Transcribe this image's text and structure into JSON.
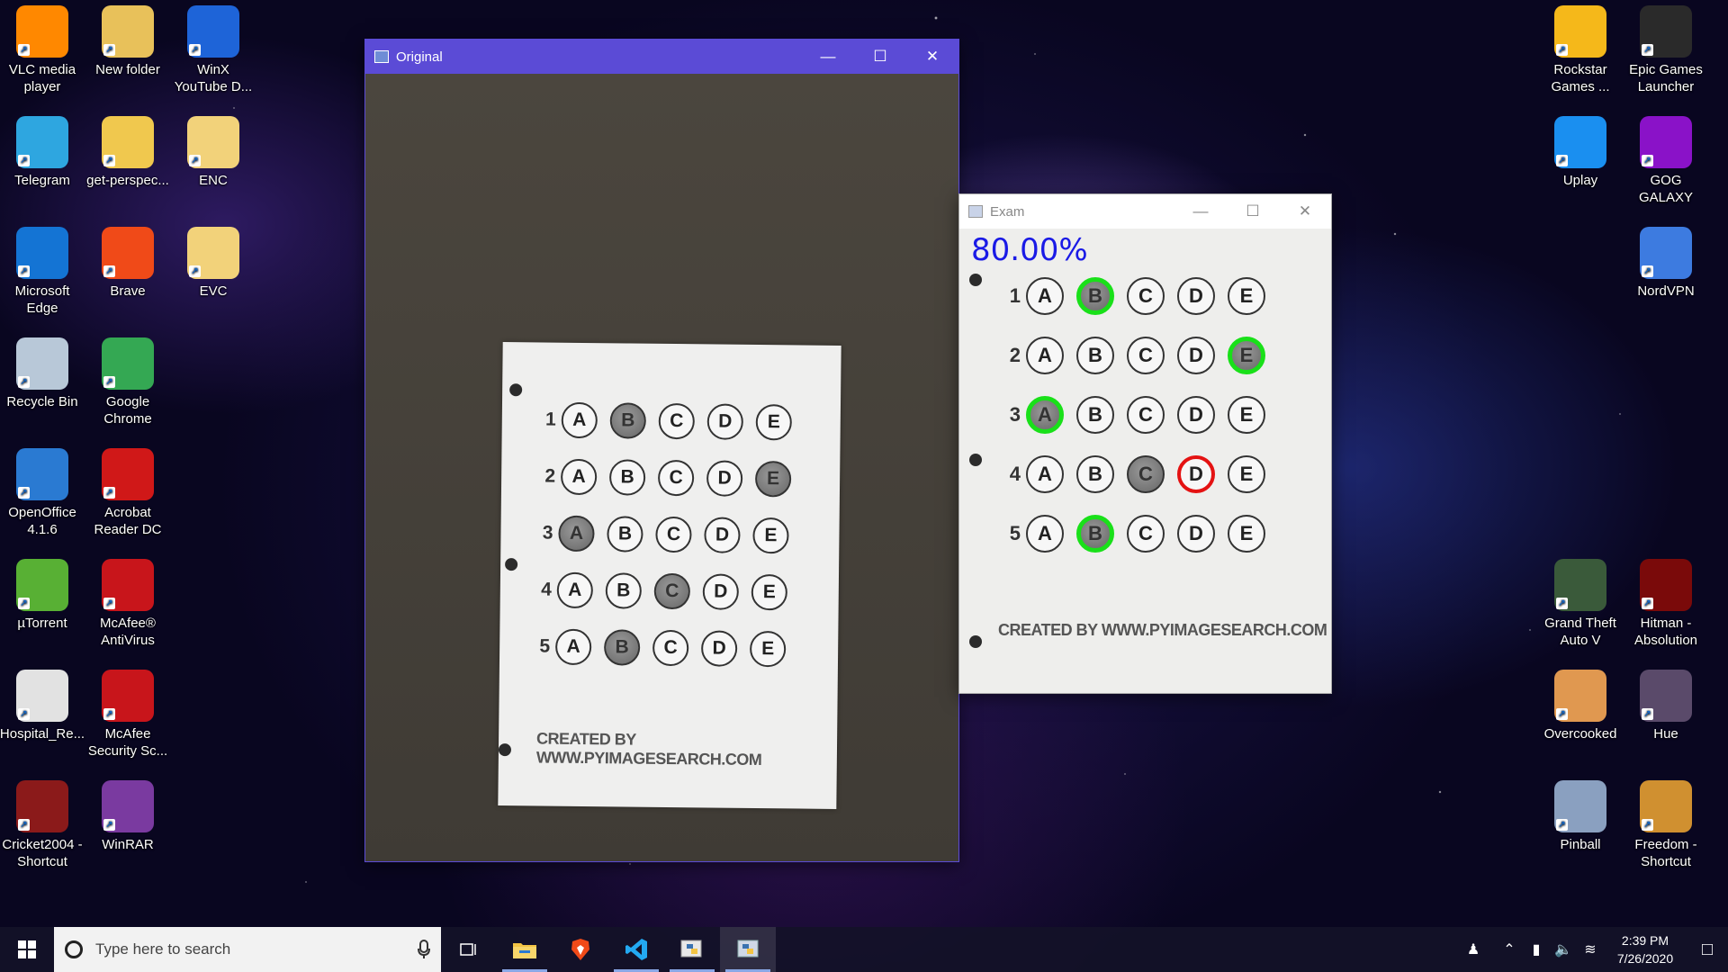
{
  "desktop": {
    "left_icons": [
      {
        "label": "VLC media player",
        "icon": "vlc-icon",
        "color": "#ff8800"
      },
      {
        "label": "New folder",
        "icon": "folder-icon",
        "color": "#e8c15a"
      },
      {
        "label": "WinX YouTube D...",
        "icon": "winx-icon",
        "color": "#1e64d8"
      },
      {
        "label": "Telegram",
        "icon": "telegram-icon",
        "color": "#2ea6e0"
      },
      {
        "label": "get-perspec...",
        "icon": "file-icon",
        "color": "#f0c84e"
      },
      {
        "label": "ENC",
        "icon": "archive-icon",
        "color": "#f2d27a"
      },
      {
        "label": "Microsoft Edge",
        "icon": "edge-icon",
        "color": "#1474d4"
      },
      {
        "label": "Brave",
        "icon": "brave-icon",
        "color": "#f04a18"
      },
      {
        "label": "EVC",
        "icon": "archive-icon",
        "color": "#f2d27a"
      },
      {
        "label": "Recycle Bin",
        "icon": "recycle-bin-icon",
        "color": "#b8c8d8"
      },
      {
        "label": "Google Chrome",
        "icon": "chrome-icon",
        "color": "#34a853"
      },
      {
        "label": "OpenOffice 4.1.6",
        "icon": "openoffice-icon",
        "color": "#2a7ad2"
      },
      {
        "label": "Acrobat Reader DC",
        "icon": "acrobat-icon",
        "color": "#d01818"
      },
      {
        "label": "µTorrent",
        "icon": "utorrent-icon",
        "color": "#58b034"
      },
      {
        "label": "McAfee® AntiVirus",
        "icon": "mcafee-icon",
        "color": "#c8151b"
      },
      {
        "label": "Hospital_Re...",
        "icon": "pdf-icon",
        "color": "#e2e2e2"
      },
      {
        "label": "McAfee Security Sc...",
        "icon": "mcafee-icon",
        "color": "#c8151b"
      },
      {
        "label": "Cricket2004 - Shortcut",
        "icon": "cricket-icon",
        "color": "#8b1a1a"
      },
      {
        "label": "WinRAR",
        "icon": "winrar-icon",
        "color": "#7a3aa0"
      }
    ],
    "right_icons": [
      {
        "label": "Rockstar Games ...",
        "icon": "rockstar-icon",
        "color": "#f5b81a"
      },
      {
        "label": "Epic Games Launcher",
        "icon": "epic-games-icon",
        "color": "#2a2a2a"
      },
      {
        "label": "Uplay",
        "icon": "uplay-icon",
        "color": "#1a8ff0"
      },
      {
        "label": "GOG GALAXY",
        "icon": "gog-galaxy-icon",
        "color": "#8a12c8"
      },
      {
        "label": "NordVPN",
        "icon": "nordvpn-icon",
        "color": "#3d7be0"
      },
      {
        "label": "Grand Theft Auto V",
        "icon": "gta-icon",
        "color": "#3a5a3a"
      },
      {
        "label": "Hitman - Absolution",
        "icon": "hitman-icon",
        "color": "#7a0a0a"
      },
      {
        "label": "Overcooked",
        "icon": "overcooked-icon",
        "color": "#e09850"
      },
      {
        "label": "Hue",
        "icon": "hue-icon",
        "color": "#5a4a6a"
      },
      {
        "label": "Pinball",
        "icon": "pinball-icon",
        "color": "#8aa0c0"
      },
      {
        "label": "Freedom - Shortcut",
        "icon": "freedom-icon",
        "color": "#d09030"
      }
    ]
  },
  "original_window": {
    "title": "Original",
    "titlebar_color": "#5b4bd6",
    "sheet": {
      "questions": [
        {
          "num": "1",
          "options": [
            "A",
            "B",
            "C",
            "D",
            "E"
          ],
          "filled": 1
        },
        {
          "num": "2",
          "options": [
            "A",
            "B",
            "C",
            "D",
            "E"
          ],
          "filled": 4
        },
        {
          "num": "3",
          "options": [
            "A",
            "B",
            "C",
            "D",
            "E"
          ],
          "filled": 0
        },
        {
          "num": "4",
          "options": [
            "A",
            "B",
            "C",
            "D",
            "E"
          ],
          "filled": 2
        },
        {
          "num": "5",
          "options": [
            "A",
            "B",
            "C",
            "D",
            "E"
          ],
          "filled": 1
        }
      ],
      "credit": "CREATED BY WWW.PYIMAGESEARCH.COM"
    }
  },
  "exam_window": {
    "title": "Exam",
    "score": "80.00%",
    "score_color": "#1a1ae6",
    "questions": [
      {
        "num": "1",
        "options": [
          "A",
          "B",
          "C",
          "D",
          "E"
        ],
        "filled": 1,
        "correct_mark": 1,
        "wrong_mark": null
      },
      {
        "num": "2",
        "options": [
          "A",
          "B",
          "C",
          "D",
          "E"
        ],
        "filled": 4,
        "correct_mark": 4,
        "wrong_mark": null
      },
      {
        "num": "3",
        "options": [
          "A",
          "B",
          "C",
          "D",
          "E"
        ],
        "filled": 0,
        "correct_mark": 0,
        "wrong_mark": null
      },
      {
        "num": "4",
        "options": [
          "A",
          "B",
          "C",
          "D",
          "E"
        ],
        "filled": 2,
        "correct_mark": null,
        "wrong_mark": 3
      },
      {
        "num": "5",
        "options": [
          "A",
          "B",
          "C",
          "D",
          "E"
        ],
        "filled": 1,
        "correct_mark": 1,
        "wrong_mark": null
      }
    ],
    "credit": "CREATED BY WWW.PYIMAGESEARCH.COM"
  },
  "taskbar": {
    "search_placeholder": "Type here to search",
    "apps": [
      "task-view-icon",
      "file-explorer-icon",
      "brave-icon",
      "vscode-icon",
      "python-idle-icon",
      "python-icon"
    ],
    "time": "2:39 PM",
    "date": "7/26/2020"
  }
}
